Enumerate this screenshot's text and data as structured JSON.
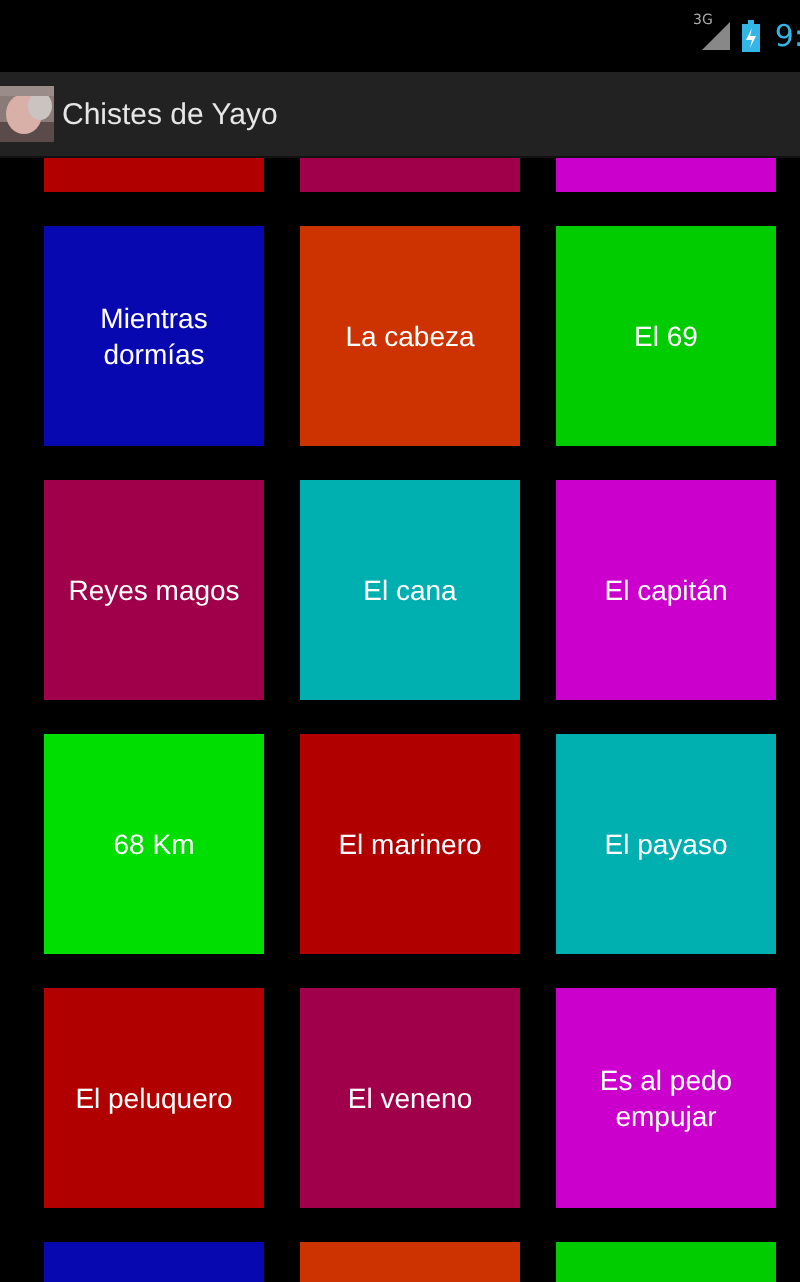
{
  "status_bar": {
    "network": "3G",
    "time": "9:"
  },
  "action_bar": {
    "title": "Chistes de Yayo"
  },
  "tiles": [
    {
      "color": "#b00000"
    },
    {
      "color": "#a0004a"
    },
    {
      "color": "#cc00cc"
    },
    {
      "label": "Mientras dormías",
      "color": "#0808b0"
    },
    {
      "label": "La cabeza",
      "color": "#cc3300"
    },
    {
      "label": "El 69",
      "color": "#00cc00"
    },
    {
      "label": "Reyes magos",
      "color": "#a0004a"
    },
    {
      "label": "El cana",
      "color": "#00b0b0"
    },
    {
      "label": "El capitán",
      "color": "#cc00cc"
    },
    {
      "label": "68 Km",
      "color": "#00dd00"
    },
    {
      "label": "El marinero",
      "color": "#b00000"
    },
    {
      "label": "El payaso",
      "color": "#00b0b0"
    },
    {
      "label": "El peluquero",
      "color": "#b00000"
    },
    {
      "label": "El veneno",
      "color": "#a0004a"
    },
    {
      "label": "Es al pedo empujar",
      "color": "#cc00cc"
    },
    {
      "color": "#0808b0"
    },
    {
      "color": "#cc3300"
    },
    {
      "color": "#00cc00"
    }
  ]
}
